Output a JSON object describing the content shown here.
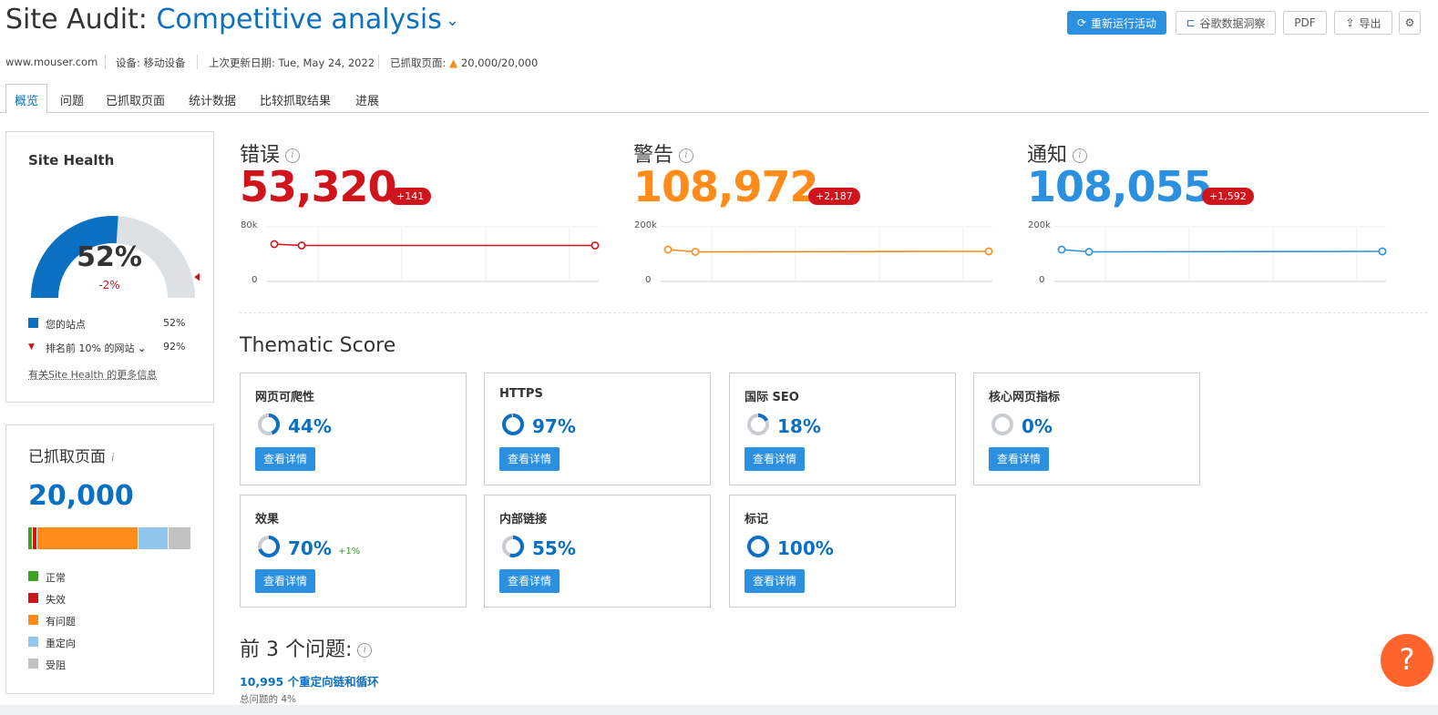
{
  "header": {
    "title_prefix": "Site Audit:",
    "project_name": "Competitive analysis",
    "buttons": {
      "rerun": "重新运行活动",
      "ga_insights": "谷歌数据洞察",
      "pdf": "PDF",
      "export": "导出"
    }
  },
  "meta": {
    "domain": "www.mouser.com",
    "device": "设备: 移动设备",
    "last_update": "上次更新日期: Tue, May 24, 2022",
    "crawled_label": "已抓取页面:",
    "crawled_value": "20,000/20,000"
  },
  "tabs": [
    "概览",
    "问题",
    "已抓取页面",
    "统计数据",
    "比较抓取结果",
    "进展"
  ],
  "site_health": {
    "title": "Site Health",
    "percent_text": "52%",
    "percent": 52,
    "change": "-2%",
    "top10_percent": 92,
    "legend": [
      {
        "label": "您的站点",
        "value": "52%"
      },
      {
        "label": "排名前 10% 的网站",
        "value": "92%"
      }
    ],
    "more_link": "有关Site Health 的更多信息"
  },
  "crawled_pages": {
    "title": "已抓取页面",
    "total": "20,000",
    "breakdown": [
      {
        "label": "正常",
        "value": "141",
        "count": 141,
        "color": "#3aa51f"
      },
      {
        "label": "失效",
        "value": "19",
        "count": 19,
        "color": "#d0141c"
      },
      {
        "label": "有问题",
        "value": "13,039",
        "count": 13039,
        "color": "#ff8c1a"
      },
      {
        "label": "重定向",
        "value": "3,815",
        "count": 3815,
        "color": "#91c6ee"
      },
      {
        "label": "受阻",
        "value": "2,986",
        "count": 2986,
        "color": "#c2c2c2"
      }
    ]
  },
  "stats": [
    {
      "label": "错误",
      "value": "53,320",
      "delta": "+141",
      "color": "#d0141c",
      "axis_top": "80k",
      "axis_bottom": "0"
    },
    {
      "label": "警告",
      "value": "108,972",
      "delta": "+2,187",
      "color": "#ff8c1a",
      "axis_top": "200k",
      "axis_bottom": "0"
    },
    {
      "label": "通知",
      "value": "108,055",
      "delta": "+1,592",
      "color": "#2b90e0",
      "axis_top": "200k",
      "axis_bottom": "0"
    }
  ],
  "thematic": {
    "title": "Thematic Score",
    "button_label": "查看详情",
    "cards": [
      {
        "title": "网页可爬性",
        "percent": 44,
        "text": "44%",
        "delta": ""
      },
      {
        "title": "HTTPS",
        "percent": 97,
        "text": "97%",
        "delta": ""
      },
      {
        "title": "国际 SEO",
        "percent": 18,
        "text": "18%",
        "delta": ""
      },
      {
        "title": "核心网页指标",
        "percent": 0,
        "text": "0%",
        "delta": ""
      },
      {
        "title": "效果",
        "percent": 70,
        "text": "70%",
        "delta": "+1%"
      },
      {
        "title": "内部链接",
        "percent": 55,
        "text": "55%",
        "delta": ""
      },
      {
        "title": "标记",
        "percent": 100,
        "text": "100%",
        "delta": ""
      }
    ]
  },
  "top_issues": {
    "title": "前 3 个问题:",
    "first_issue": "10,995 个重定向链和循环",
    "first_issue_share": "总问题的 4%"
  },
  "help": "?"
}
